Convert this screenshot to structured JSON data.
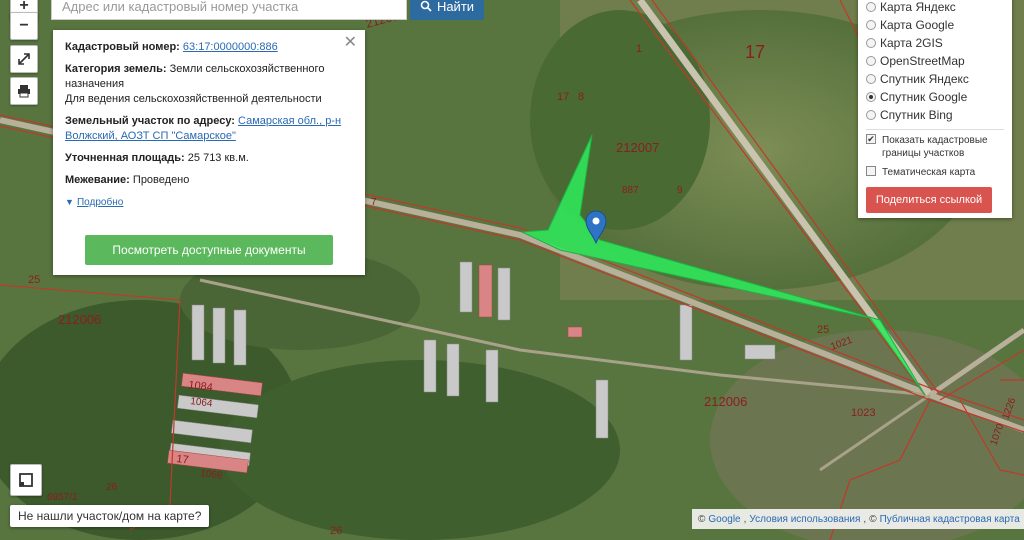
{
  "search": {
    "placeholder": "Адрес или кадастровый номер участка",
    "button": "Найти"
  },
  "info": {
    "cadastral_label": "Кадастровый номер:",
    "cadastral_value": "63:17:0000000:886",
    "category_label": "Категория земель:",
    "category_value": "Земли сельскохозяйственного назначения",
    "usage": "Для ведения сельскохозяйственной деятельности",
    "address_label": "Земельный участок по адресу:",
    "address_value": "Самарская обл., р-н Волжский, АОЗТ СП \"Самарское\"",
    "area_label": "Уточненная площадь:",
    "area_value": "25 713 кв.м.",
    "survey_label": "Межевание:",
    "survey_value": "Проведено",
    "details": "Подробно",
    "docs_button": "Посмотреть доступные документы"
  },
  "layers": {
    "options": [
      "Карта Яндекс",
      "Карта Google",
      "Карта 2GIS",
      "OpenStreetMap",
      "Спутник Яндекс",
      "Спутник Google",
      "Спутник Bing"
    ],
    "selected": "Спутник Google",
    "show_borders": "Показать кадастровые границы участков",
    "show_borders_checked": true,
    "thematic": "Тематическая карта",
    "thematic_checked": false,
    "share_button": "Поделиться ссылкой"
  },
  "not_found": "Не нашли участок/дом на карте?",
  "attribution": {
    "copyright": "©",
    "google": "Google",
    "terms": "Условия использования",
    "pkk": "Публичная кадастровая карта"
  },
  "map_labels": [
    "212007",
    "17",
    "1",
    "17",
    "8",
    "212007",
    "887",
    "9",
    "7",
    "25",
    "212006",
    "1084",
    "1064",
    "17",
    "1066",
    "6957/1",
    "26",
    "26",
    "25",
    "1021",
    "212006",
    "1023",
    "1070",
    "1226"
  ],
  "colors": {
    "parcel": "#2ee85a",
    "borders": "#c0392b",
    "primary": "#2c6aa0",
    "green_btn": "#5cb85c",
    "red_btn": "#d9534f"
  }
}
